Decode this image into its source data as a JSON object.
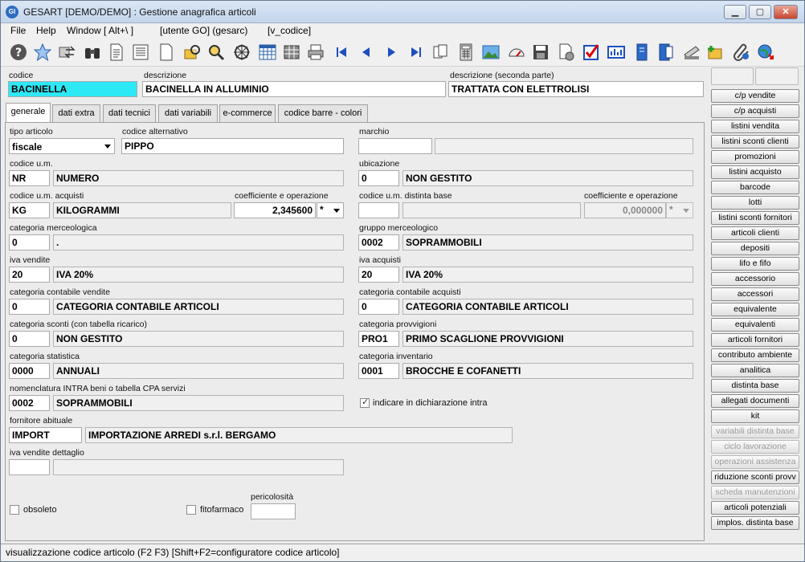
{
  "window": {
    "title": "GESART [DEMO/DEMO] : Gestione anagrafica articoli",
    "app_icon": "GI"
  },
  "menu": [
    "File",
    "Help",
    "Window [ Alt+\\ ]",
    "[utente GO] (gesarc)",
    "[v_codice]"
  ],
  "toolbar_icons": [
    "help-icon",
    "star-icon",
    "transfer-icon",
    "binoculars-icon",
    "document-icon",
    "list-document-icon",
    "new-document-icon",
    "search-folder-icon",
    "search-icon",
    "wheel-icon",
    "calendar-grid-icon",
    "grid-icon",
    "printer-icon",
    "first-record-icon",
    "previous-record-icon",
    "next-record-icon",
    "last-record-icon",
    "copy-icon",
    "calculator-icon",
    "image-icon",
    "gauge-icon",
    "save-icon",
    "delete-document-icon",
    "checkbox-icon",
    "chart-icon",
    "book-icon",
    "book-alt-icon",
    "scanner-icon",
    "add-folder-icon",
    "attachment-icon",
    "globe-export-icon"
  ],
  "header": {
    "codice_label": "codice",
    "codice_value": "BACINELLA",
    "descrizione_label": "descrizione",
    "descrizione_value": "BACINELLA IN ALLUMINIO",
    "descrizione2_label": "descrizione (seconda parte)",
    "descrizione2_value": "TRATTATA CON ELETTROLISI"
  },
  "tabs": [
    "generale",
    "dati extra",
    "dati tecnici",
    "dati variabili",
    "e-commerce",
    "codice barre - colori"
  ],
  "form": {
    "tipo_articolo": {
      "label": "tipo articolo",
      "value": "fiscale"
    },
    "codice_alternativo": {
      "label": "codice alternativo",
      "value": "PIPPO"
    },
    "marchio": {
      "label": "marchio",
      "code": "",
      "desc": ""
    },
    "codice_um": {
      "label": "codice u.m.",
      "code": "NR",
      "desc": "NUMERO"
    },
    "ubicazione": {
      "label": "ubicazione",
      "code": "0",
      "desc": "NON GESTITO"
    },
    "codice_um_acquisti": {
      "label": "codice u.m. acquisti",
      "code": "KG",
      "desc": "KILOGRAMMI"
    },
    "coeff_acquisti": {
      "label": "coefficiente e operazione",
      "value": "2,345600",
      "op": "*"
    },
    "codice_um_distinta": {
      "label": "codice u.m. distinta base",
      "code": "",
      "desc": ""
    },
    "coeff_distinta": {
      "label": "coefficiente e operazione",
      "value": "0,000000",
      "op": "*"
    },
    "categoria_merceologica": {
      "label": "categoria merceologica",
      "code": "0",
      "desc": "."
    },
    "gruppo_merceologico": {
      "label": "gruppo merceologico",
      "code": "0002",
      "desc": "SOPRAMMOBILI"
    },
    "iva_vendite": {
      "label": "iva vendite",
      "code": "20",
      "desc": "IVA 20%"
    },
    "iva_acquisti": {
      "label": "iva acquisti",
      "code": "20",
      "desc": "IVA 20%"
    },
    "cat_contabile_vendite": {
      "label": "categoria contabile vendite",
      "code": "0",
      "desc": "CATEGORIA CONTABILE ARTICOLI"
    },
    "cat_contabile_acquisti": {
      "label": "categoria contabile acquisti",
      "code": "0",
      "desc": "CATEGORIA CONTABILE ARTICOLI"
    },
    "categoria_sconti": {
      "label": "categoria sconti (con tabella ricarico)",
      "code": "0",
      "desc": "NON GESTITO"
    },
    "categoria_provvigioni": {
      "label": "categoria provvigioni",
      "code": "PRO1",
      "desc": "PRIMO SCAGLIONE PROVVIGIONI"
    },
    "categoria_statistica": {
      "label": "categoria statistica",
      "code": "0000",
      "desc": "ANNUALI"
    },
    "categoria_inventario": {
      "label": "categoria inventario",
      "code": "0001",
      "desc": "BROCCHE E COFANETTI"
    },
    "nomenclatura_intra": {
      "label": "nomenclatura INTRA beni o tabella CPA servizi",
      "code": "0002",
      "desc": "SOPRAMMOBILI"
    },
    "indicare_intra": {
      "label": "indicare in dichiarazione intra",
      "checked": true
    },
    "fornitore_abituale": {
      "label": "fornitore abituale",
      "code": "IMPORT",
      "desc": "IMPORTAZIONE ARREDI s.r.l. BERGAMO"
    },
    "iva_vendite_dettaglio": {
      "label": "iva vendite dettaglio",
      "code": "",
      "desc": ""
    },
    "obsoleto": {
      "label": "obsoleto",
      "checked": false
    },
    "fitofarmaco": {
      "label": "fitofarmaco",
      "checked": false
    },
    "pericolosita": {
      "label": "pericolosità",
      "value": ""
    }
  },
  "side_buttons": [
    {
      "label": "c/p vendite",
      "enabled": true
    },
    {
      "label": "c/p acquisti",
      "enabled": true
    },
    {
      "label": "listini vendita",
      "enabled": true
    },
    {
      "label": "listini sconti clienti",
      "enabled": true
    },
    {
      "label": "promozioni",
      "enabled": true
    },
    {
      "label": "listini acquisto",
      "enabled": true
    },
    {
      "label": "barcode",
      "enabled": true
    },
    {
      "label": "lotti",
      "enabled": true
    },
    {
      "label": "listini sconti fornitori",
      "enabled": true
    },
    {
      "label": "articoli clienti",
      "enabled": true
    },
    {
      "label": "depositi",
      "enabled": true
    },
    {
      "label": "lifo e fifo",
      "enabled": true
    },
    {
      "label": "accessorio",
      "enabled": true
    },
    {
      "label": "accessori",
      "enabled": true
    },
    {
      "label": "equivalente",
      "enabled": true
    },
    {
      "label": "equivalenti",
      "enabled": true
    },
    {
      "label": "articoli fornitori",
      "enabled": true
    },
    {
      "label": "contributo ambiente",
      "enabled": true
    },
    {
      "label": "analitica",
      "enabled": true
    },
    {
      "label": "distinta base",
      "enabled": true
    },
    {
      "label": "allegati documenti",
      "enabled": true
    },
    {
      "label": "kit",
      "enabled": true
    },
    {
      "label": "variabili distinta base",
      "enabled": false
    },
    {
      "label": "ciclo lavorazione",
      "enabled": false
    },
    {
      "label": "operazioni assistenza",
      "enabled": false
    },
    {
      "label": "riduzione sconti provv",
      "enabled": true
    },
    {
      "label": "scheda manutenzioni",
      "enabled": false
    },
    {
      "label": "articoli potenziali",
      "enabled": true
    },
    {
      "label": "implos. distinta base",
      "enabled": true
    }
  ],
  "status": {
    "mode": "visualizzazione",
    "hint": "codice articolo (F2 F3) [Shift+F2=configuratore codice articolo]"
  },
  "colors": {
    "codice_highlight": "#2de8f5",
    "title_bar": "#c3d5ec"
  }
}
